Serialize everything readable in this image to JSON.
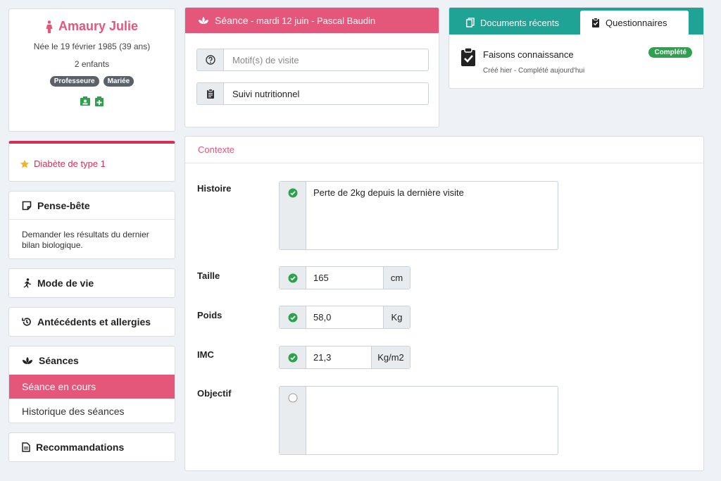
{
  "patient": {
    "name": "Amaury Julie",
    "birth": "Née le 19 février 1985 (39 ans)",
    "children": "2 enfants",
    "tags": [
      "Professeure",
      "Mariée"
    ],
    "colors": {
      "accent": "#e4567a",
      "tag_bg": "#5b6069",
      "icon_green": "#2ca24d"
    }
  },
  "alert": {
    "label": "Diabète de type 1",
    "color": "#d42f57"
  },
  "sidebar": {
    "pense_bete": {
      "title": "Pense-bête",
      "note": "Demander les résultats du dernier bilan biologique."
    },
    "mode_de_vie": {
      "title": "Mode de vie"
    },
    "antecedents": {
      "title": "Antécédents et allergies"
    },
    "seances": {
      "title": "Séances",
      "items": [
        {
          "label": "Séance en cours",
          "active": true
        },
        {
          "label": "Historique des séances",
          "active": false
        }
      ]
    },
    "recommandations": {
      "title": "Recommandations"
    }
  },
  "seance": {
    "title": "Séance",
    "subtitle": " - mardi 12 juin - Pascal Baudin",
    "motif_placeholder": "Motif(s) de visite",
    "type_value": "Suivi nutritionnel"
  },
  "documents": {
    "tabs": [
      {
        "label": "Documents récents",
        "active": false
      },
      {
        "label": "Questionnaires",
        "active": true
      }
    ],
    "questionnaire": {
      "title": "Faisons connaissance",
      "meta": "Créé hier - Complété aujourd'hui",
      "status": "Complété",
      "status_color": "#2ca24d"
    },
    "tab_color": "#1fa394"
  },
  "contexte": {
    "title": "Contexte",
    "fields": {
      "histoire": {
        "label": "Histoire",
        "value": "Perte de 2kg depuis la dernière visite",
        "checked": true
      },
      "taille": {
        "label": "Taille",
        "value": "165",
        "unit": "cm",
        "checked": true
      },
      "poids": {
        "label": "Poids",
        "value": "58,0",
        "unit": "Kg",
        "checked": true
      },
      "imc": {
        "label": "IMC",
        "value": "21,3",
        "unit": "Kg/m2",
        "checked": true
      },
      "objectif": {
        "label": "Objectif",
        "value": "",
        "checked": false
      }
    }
  }
}
